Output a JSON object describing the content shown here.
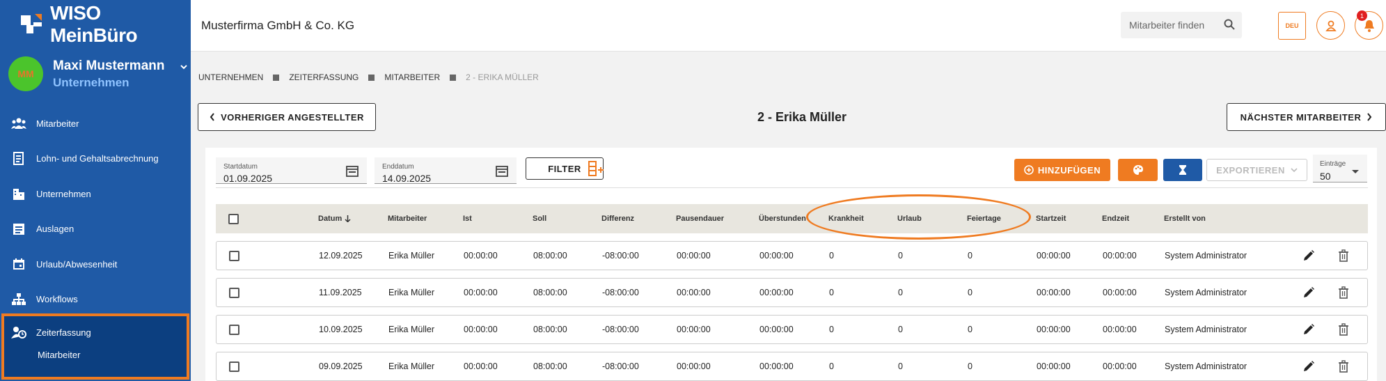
{
  "app": {
    "name": "WISO MeinBüro"
  },
  "user": {
    "name": "Maxi Mustermann",
    "role": "Unternehmen",
    "initials": "MM"
  },
  "sidebar": {
    "items": [
      {
        "label": "Mitarbeiter",
        "icon": "people-icon"
      },
      {
        "label": "Lohn- und Gehaltsabrechnung",
        "icon": "document-icon"
      },
      {
        "label": "Unternehmen",
        "icon": "building-icon"
      },
      {
        "label": "Auslagen",
        "icon": "list-icon"
      },
      {
        "label": "Urlaub/Abwesenheit",
        "icon": "calendar-icon"
      },
      {
        "label": "Workflows",
        "icon": "workflow-icon"
      }
    ],
    "active": {
      "label": "Zeiterfassung",
      "icon": "person-clock-icon",
      "sub": "Mitarbeiter"
    }
  },
  "topbar": {
    "company": "Musterfirma GmbH & Co. KG",
    "search_placeholder": "Mitarbeiter finden",
    "language": "DEU",
    "notifications": "1"
  },
  "breadcrumb": [
    "UNTERNEHMEN",
    "ZEITERFASSUNG",
    "MITARBEITER",
    "2 - ERIKA MÜLLER"
  ],
  "navigation": {
    "previous": "VORHERIGER ANGESTELLTER",
    "next": "NÄCHSTER MITARBEITER",
    "title": "2 - Erika Müller"
  },
  "filters": {
    "start_label": "Startdatum",
    "start_value": "01.09.2025",
    "end_label": "Enddatum",
    "end_value": "14.09.2025",
    "filter_button": "FILTER",
    "add_button": "HINZUFÜGEN",
    "export_button": "EXPORTIEREN",
    "entries_label": "Einträge",
    "entries_value": "50"
  },
  "colors": {
    "sidebar": "#1f5aa6",
    "accent": "#ef7b21",
    "active": "#0c3f80"
  },
  "table": {
    "columns": [
      "Datum",
      "Mitarbeiter",
      "Ist",
      "Soll",
      "Differenz",
      "Pausendauer",
      "Überstunden",
      "Krankheit",
      "Urlaub",
      "Feiertage",
      "Startzeit",
      "Endzeit",
      "Erstellt von"
    ],
    "rows": [
      [
        "12.09.2025",
        "Erika Müller",
        "00:00:00",
        "08:00:00",
        "-08:00:00",
        "00:00:00",
        "00:00:00",
        "0",
        "0",
        "0",
        "00:00:00",
        "00:00:00",
        "System Administrator"
      ],
      [
        "11.09.2025",
        "Erika Müller",
        "00:00:00",
        "08:00:00",
        "-08:00:00",
        "00:00:00",
        "00:00:00",
        "0",
        "0",
        "0",
        "00:00:00",
        "00:00:00",
        "System Administrator"
      ],
      [
        "10.09.2025",
        "Erika Müller",
        "00:00:00",
        "08:00:00",
        "-08:00:00",
        "00:00:00",
        "00:00:00",
        "0",
        "0",
        "0",
        "00:00:00",
        "00:00:00",
        "System Administrator"
      ],
      [
        "09.09.2025",
        "Erika Müller",
        "00:00:00",
        "08:00:00",
        "-08:00:00",
        "00:00:00",
        "00:00:00",
        "0",
        "0",
        "0",
        "00:00:00",
        "00:00:00",
        "System Administrator"
      ]
    ]
  }
}
